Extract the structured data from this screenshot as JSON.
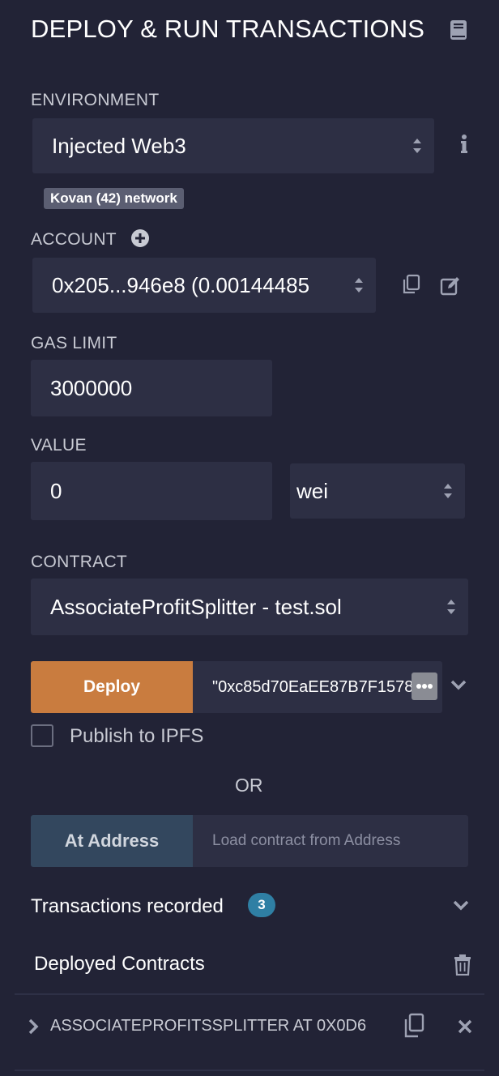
{
  "header": {
    "title": "DEPLOY & RUN TRANSACTIONS",
    "icon": "book-icon"
  },
  "environment": {
    "label": "ENVIRONMENT",
    "value": "Injected Web3",
    "network_badge": "Kovan (42) network",
    "info_icon": "info-icon"
  },
  "account": {
    "label": "ACCOUNT",
    "value": "0x205...946e8 (0.00144485",
    "add_icon": "plus-circle-icon",
    "copy_icon": "copy-icon",
    "edit_icon": "edit-icon"
  },
  "gas_limit": {
    "label": "GAS LIMIT",
    "value": "3000000"
  },
  "value": {
    "label": "VALUE",
    "amount": "0",
    "unit": "wei"
  },
  "contract": {
    "label": "CONTRACT",
    "value": "AssociateProfitSplitter - test.sol"
  },
  "deploy": {
    "button_label": "Deploy",
    "args_value": "\"0xc85d70EaEE87B7F1578",
    "publish_label": "Publish to IPFS",
    "or_label": "OR"
  },
  "at_address": {
    "button_label": "At Address",
    "placeholder": "Load contract from Address"
  },
  "transactions": {
    "label": "Transactions recorded",
    "count": "3"
  },
  "deployed": {
    "label": "Deployed Contracts",
    "instance_label": "ASSOCIATEPROFITSSPLITTER AT 0X0D6"
  },
  "colors": {
    "background": "#222336",
    "field": "#2d2f44",
    "deploy": "#c97c3f",
    "at_address": "#33475e",
    "badge": "#2f7fa4"
  }
}
